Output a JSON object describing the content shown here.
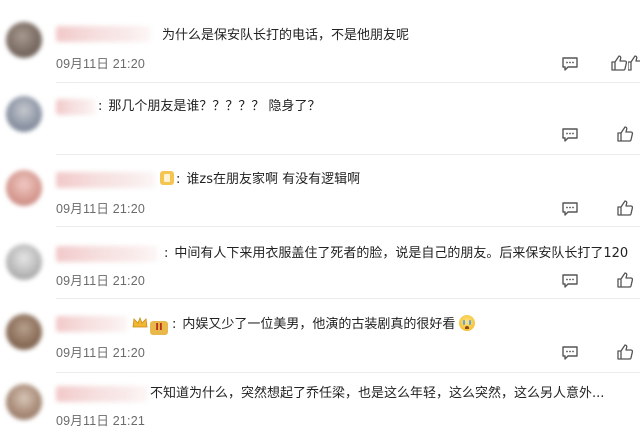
{
  "comments": [
    {
      "text": "为什么是保安队长打的电话，不是他朋友呢",
      "time": "09月11日 21:20"
    },
    {
      "text": "那几个朋友是谁？？？？？ 隐身了？",
      "time": ""
    },
    {
      "text": "谁zs在朋友家啊 有没有逻辑啊",
      "time": "09月11日 21:20"
    },
    {
      "text": "中间有人下来用衣服盖住了死者的脸，说是自己的朋友。后来保安队长打了120",
      "time": "09月11日 21:20"
    },
    {
      "text": "内娱又少了一位美男，他演的古装剧真的很好看",
      "time": "09月11日 21:20"
    },
    {
      "text": "不知道为什么，突然想起了乔任梁，也是这么年轻，这么突然，这么另人意外...",
      "time": "09月11日 21:21"
    }
  ],
  "icons": {
    "comment": "comment-bubble-icon",
    "like": "thumbs-up-icon",
    "reaction": "crying-emoji-icon"
  },
  "colors": {
    "icon": "#555555",
    "time": "#6b6b6b",
    "divider": "#ececec"
  }
}
